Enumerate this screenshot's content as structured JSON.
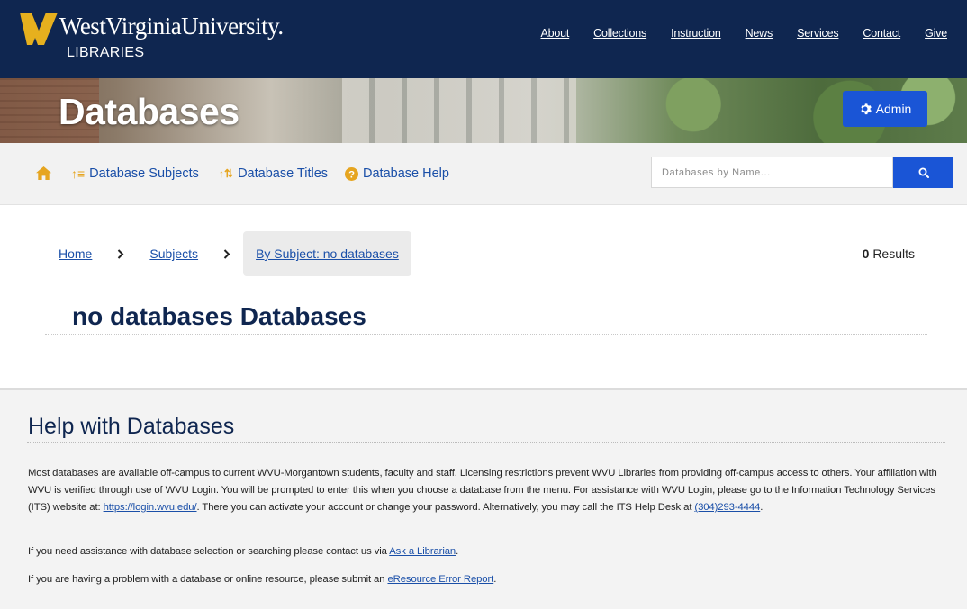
{
  "header": {
    "logo_university": "WestVirginiaUniversity.",
    "logo_libraries": "LIBRARIES",
    "nav": [
      "About",
      "Collections",
      "Instruction",
      "News",
      "Services",
      "Contact",
      "Give"
    ]
  },
  "banner": {
    "title": "Databases",
    "admin_label": "Admin"
  },
  "subnav": {
    "home_icon": "home-icon",
    "subjects_label": "Database Subjects",
    "titles_label": "Database Titles",
    "help_label": "Database Help",
    "search_placeholder": "Databases by Name..."
  },
  "breadcrumb": {
    "home": "Home",
    "subjects": "Subjects",
    "current": "By Subject: no databases"
  },
  "results": {
    "count": "0",
    "label": "Results"
  },
  "subject_title": "no databases Databases",
  "help": {
    "heading": "Help with Databases",
    "p1_text": "Most databases are available off-campus to current WVU-Morgantown students, faculty and staff. Licensing restrictions prevent WVU Libraries from providing off-campus access to others. Your affiliation with WVU is verified through use of WVU Login. You will be prompted to enter this when you choose a database from the menu. For assistance with WVU Login, please go to the Information Technology Services (ITS) website at: ",
    "p1_link": "https://login.wvu.edu/",
    "p1_text2": ". There you can activate your account or change your password. Alternatively, you may call the ITS Help Desk at ",
    "p1_phone": "(304)293-4444",
    "p1_end": ".",
    "p2_text": "If you need assistance with database selection or searching please contact us via ",
    "p2_link": "Ask a Librarian",
    "p2_end": ".",
    "p3_text": "If you are having a problem with a database or online resource, please submit an ",
    "p3_link": "eResource Error Report",
    "p3_end": "."
  },
  "colors": {
    "navy": "#0f2650",
    "gold": "#e6a520",
    "accent_blue": "#1a55d6",
    "link": "#1a4fa8"
  }
}
